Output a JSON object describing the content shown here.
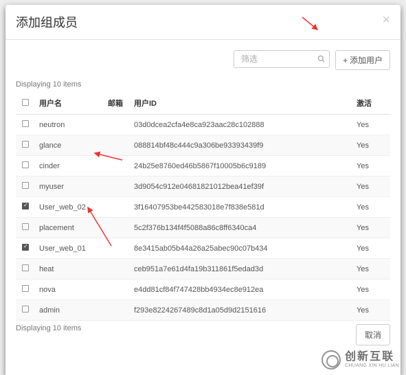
{
  "modal": {
    "title": "添加组成员",
    "close_label": "×"
  },
  "toolbar": {
    "filter_placeholder": "筛选",
    "add_icon": "+",
    "add_label": "添加用户"
  },
  "table": {
    "display_text": "Displaying 10 items",
    "columns": {
      "username": "用户名",
      "email": "邮箱",
      "userid": "用户ID",
      "active": "激活"
    },
    "rows": [
      {
        "checked": false,
        "username": "neutron",
        "email": "",
        "userid": "03d0dcea2cfa4e8ca923aac28c102888",
        "active": "Yes"
      },
      {
        "checked": false,
        "username": "glance",
        "email": "",
        "userid": "088814bf48c444c9a306be93393439f9",
        "active": "Yes"
      },
      {
        "checked": false,
        "username": "cinder",
        "email": "",
        "userid": "24b25e8760ed46b5867f10005b6c9189",
        "active": "Yes"
      },
      {
        "checked": false,
        "username": "myuser",
        "email": "",
        "userid": "3d9054c912e04681821012bea41ef39f",
        "active": "Yes"
      },
      {
        "checked": true,
        "username": "User_web_02",
        "email": "",
        "userid": "3f16407953be442583018e7f838e581d",
        "active": "Yes"
      },
      {
        "checked": false,
        "username": "placement",
        "email": "",
        "userid": "5c2f376b134f4f5088a86c8ff6340ca4",
        "active": "Yes"
      },
      {
        "checked": true,
        "username": "User_web_01",
        "email": "",
        "userid": "8e3415ab05b44a26a25abec90c07b434",
        "active": "Yes"
      },
      {
        "checked": false,
        "username": "heat",
        "email": "",
        "userid": "ceb951a7e61d4fa19b311861f5edad3d",
        "active": "Yes"
      },
      {
        "checked": false,
        "username": "nova",
        "email": "",
        "userid": "e4dd81cf84f747428bb4934ec8e912ea",
        "active": "Yes"
      },
      {
        "checked": false,
        "username": "admin",
        "email": "",
        "userid": "f293e8224267489c8d1a05d9d2151616",
        "active": "Yes"
      }
    ]
  },
  "footer": {
    "cancel": "取消"
  },
  "watermark": {
    "main": "创新互联",
    "sub": "CHUANG XIN HU LIAN"
  }
}
